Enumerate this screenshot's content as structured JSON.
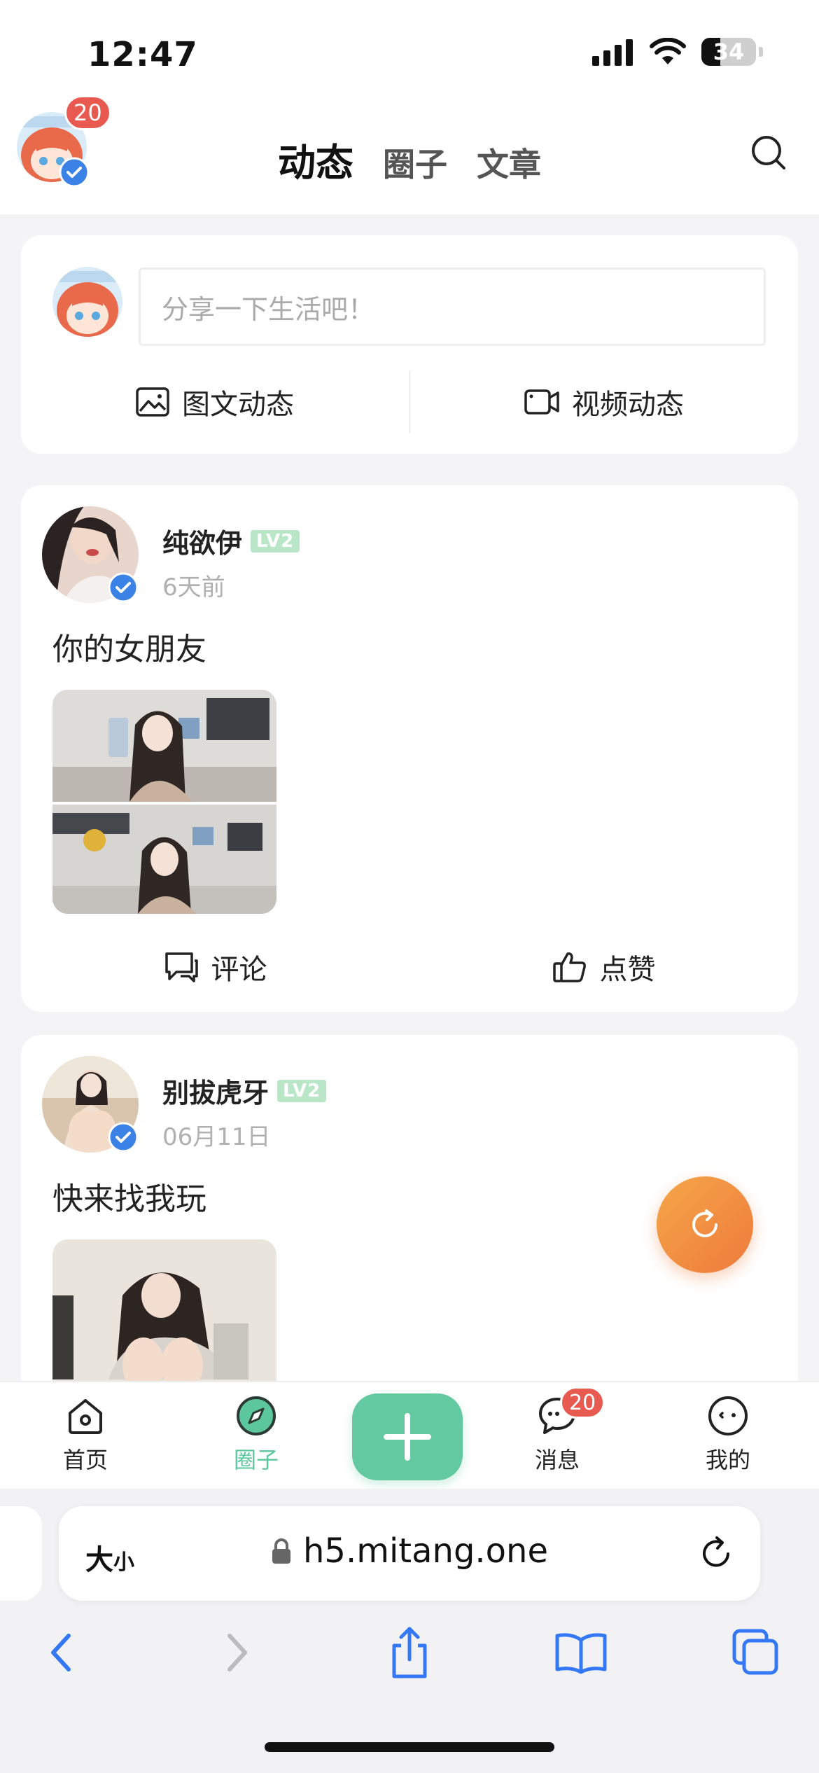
{
  "status_bar": {
    "time": "12:47",
    "battery_level": "34"
  },
  "top_nav": {
    "avatar_badge": "20",
    "tabs": [
      {
        "label": "动态",
        "active": true
      },
      {
        "label": "圈子",
        "active": false
      },
      {
        "label": "文章",
        "active": false
      }
    ],
    "search_icon": "search-icon"
  },
  "composer": {
    "placeholder": "分享一下生活吧！",
    "photo_post_label": "图文动态",
    "video_post_label": "视频动态"
  },
  "posts": [
    {
      "username": "纯欲伊",
      "level": "LV2",
      "time": "6天前",
      "text": "你的女朋友",
      "comment_label": "评论",
      "like_label": "点赞"
    },
    {
      "username": "别拔虎牙",
      "level": "LV2",
      "time": "06月11日",
      "text": "快来找我玩"
    }
  ],
  "tab_bar": {
    "items": [
      {
        "label": "首页",
        "icon": "home-icon"
      },
      {
        "label": "圈子",
        "icon": "compass-icon",
        "active": true
      },
      {
        "label": "消息",
        "icon": "message-icon",
        "badge": "20"
      },
      {
        "label": "我的",
        "icon": "profile-icon"
      }
    ],
    "plus_icon": "plus-icon"
  },
  "browser": {
    "size_label_big": "大",
    "size_label_small": "小",
    "url": "h5.mitang.one"
  },
  "colors": {
    "accent_green": "#62c9a0",
    "badge_red": "#e85a4f",
    "fab_orange": "#ee7a3a",
    "safari_blue": "#3478f6"
  }
}
